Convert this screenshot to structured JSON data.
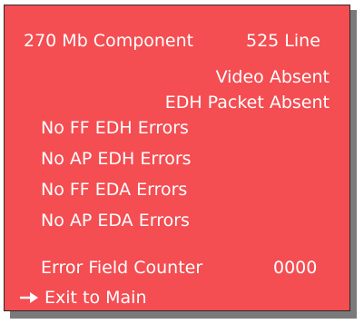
{
  "colors": {
    "panel_background": "#f44d52",
    "text": "#ffffff",
    "shadow": "#7a7a7a"
  },
  "header": {
    "mode": "270 Mb Component",
    "lines": "525 Line"
  },
  "status": {
    "video": "Video Absent",
    "edh_packet": "EDH Packet Absent"
  },
  "errors": [
    "No FF EDH Errors",
    "No AP EDH Errors",
    "No FF EDA Errors",
    "No AP EDA Errors"
  ],
  "counter": {
    "label": "Error Field Counter",
    "value": "0000"
  },
  "menu": {
    "selected_icon": "right-arrow-icon",
    "exit_label": "Exit to Main"
  }
}
